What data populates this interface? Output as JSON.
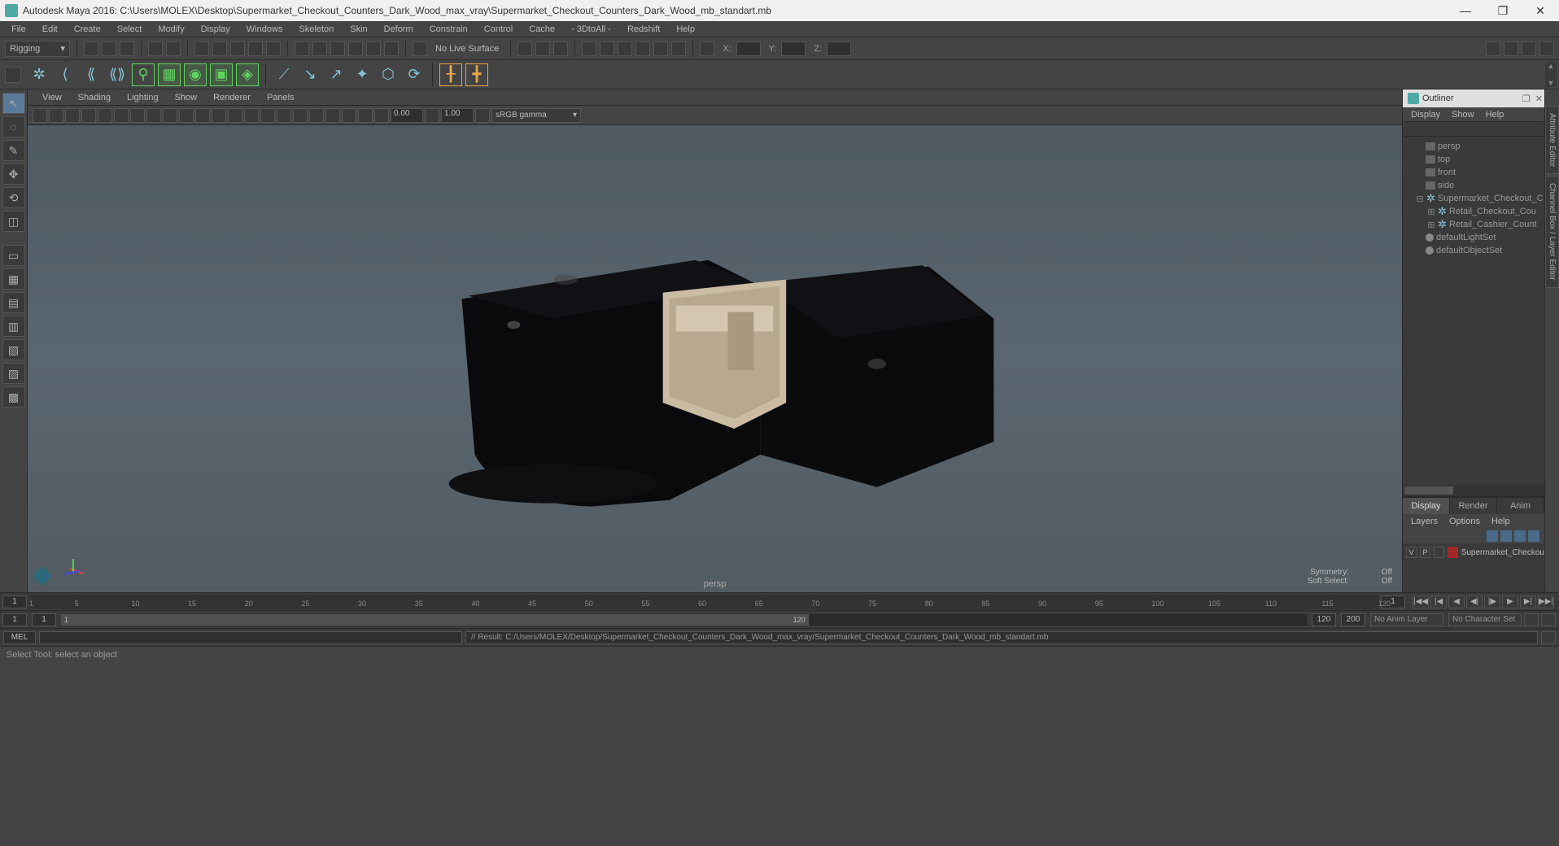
{
  "app": {
    "title": "Autodesk Maya 2016: C:\\Users\\MOLEX\\Desktop\\Supermarket_Checkout_Counters_Dark_Wood_max_vray\\Supermarket_Checkout_Counters_Dark_Wood_mb_standart.mb"
  },
  "window_controls": {
    "minimize": "—",
    "maximize": "❐",
    "close": "✕"
  },
  "menubar": [
    "File",
    "Edit",
    "Create",
    "Select",
    "Modify",
    "Display",
    "Windows",
    "Skeleton",
    "Skin",
    "Deform",
    "Constrain",
    "Control",
    "Cache",
    "- 3DtoAll -",
    "Redshift",
    "Help"
  ],
  "shelf1": {
    "mode": "Rigging",
    "mode_arrow": "▾",
    "live": "No Live Surface",
    "coords": {
      "x": "X:",
      "y": "Y:",
      "z": "Z:"
    }
  },
  "viewport_menu": [
    "View",
    "Shading",
    "Lighting",
    "Show",
    "Renderer",
    "Panels"
  ],
  "viewport_toolbar": {
    "near": "0.00",
    "far": "1.00",
    "gamma": "sRGB gamma",
    "gamma_arrow": "▾"
  },
  "viewport": {
    "camera": "persp",
    "hud": {
      "symmetry_label": "Symmetry:",
      "symmetry_value": "Off",
      "soft_label": "Soft Select:",
      "soft_value": "Off"
    }
  },
  "outliner": {
    "title": "Outliner",
    "menu": [
      "Display",
      "Show",
      "Help"
    ],
    "cameras": [
      "persp",
      "top",
      "front",
      "side"
    ],
    "nodes": [
      "Supermarket_Checkout_C",
      "Retail_Checkout_Cou",
      "Retail_Cashier_Count",
      "defaultLightSet",
      "defaultObjectSet"
    ],
    "expand_plus": "⊞",
    "expand_minus": "⊟"
  },
  "layers": {
    "tabs": [
      "Display",
      "Render",
      "Anim"
    ],
    "menu": [
      "Layers",
      "Options",
      "Help"
    ],
    "v": "V",
    "p": "P",
    "row_name": "Supermarket_Checkou"
  },
  "sidetabs": [
    "Attribute Editor",
    "Channel Box / Layer Editor"
  ],
  "timeslider": {
    "start": "1",
    "end": "1",
    "ticks": [
      1,
      5,
      10,
      15,
      20,
      25,
      30,
      35,
      40,
      45,
      50,
      55,
      60,
      65,
      70,
      75,
      80,
      85,
      90,
      95,
      100,
      105,
      110,
      115,
      120
    ]
  },
  "playback": {
    "first": "|◀◀",
    "prevkey": "|◀",
    "prev": "◀",
    "stepb": "◀|",
    "stepf": "|▶",
    "play": "▶",
    "nextkey": "▶|",
    "last": "▶▶|"
  },
  "rangeslider": {
    "outer_start": "1",
    "inner_start": "1",
    "inner_end": "120",
    "outer_end": "120",
    "end2": "200",
    "anim_layer": "No Anim Layer",
    "char_set": "No Character Set"
  },
  "cmdline": {
    "lang": "MEL",
    "result": "// Result: C:/Users/MOLEX/Desktop/Supermarket_Checkout_Counters_Dark_Wood_max_vray/Supermarket_Checkout_Counters_Dark_Wood_mb_standart.mb"
  },
  "helpline": "Select Tool: select an object"
}
